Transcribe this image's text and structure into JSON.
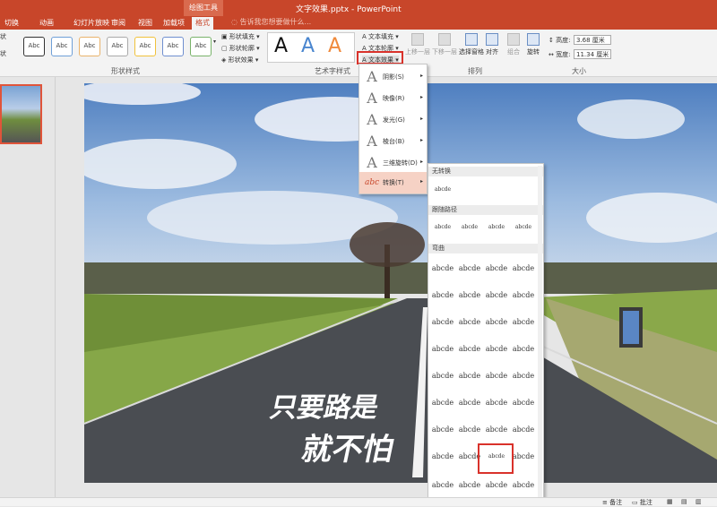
{
  "window": {
    "title": "文字效果.pptx - PowerPoint",
    "context_tab": "绘图工具"
  },
  "tabs": [
    "切换",
    "动画",
    "幻灯片放映",
    "审阅",
    "视图",
    "加载项",
    "格式"
  ],
  "active_tab": "格式",
  "tell_me": "告诉我您想要做什么...",
  "ribbon": {
    "left_partial": [
      "状",
      "状"
    ],
    "shape_styles": [
      "Abc",
      "Abc",
      "Abc",
      "Abc",
      "Abc",
      "Abc",
      "Abc"
    ],
    "shape_styles_label": "形状样式",
    "shape_fill": "形状填充",
    "shape_outline": "形状轮廓",
    "shape_effects": "形状效果",
    "wordart_samples": [
      "A",
      "A",
      "A"
    ],
    "wordart_label": "艺术字样式",
    "text_fill": "文本填充",
    "text_outline": "文本轮廓",
    "text_effects": "文本效果",
    "arrange": {
      "bring_forward": "上移一层",
      "send_backward": "下移一层",
      "selection_pane": "选择窗格",
      "align": "对齐",
      "group": "组合",
      "rotate": "旋转",
      "label": "排列"
    },
    "size": {
      "height_label": "高度:",
      "height_value": "3.68 厘米",
      "width_label": "宽度:",
      "width_value": "11.34 厘米",
      "label": "大小"
    }
  },
  "text_effects_menu": [
    {
      "label": "阴影(S)"
    },
    {
      "label": "映像(R)"
    },
    {
      "label": "发光(G)"
    },
    {
      "label": "棱台(B)"
    },
    {
      "label": "三维旋转(D)"
    },
    {
      "label": "转换(T)"
    }
  ],
  "transform_gallery": {
    "no_transform": "无转换",
    "no_transform_sample": "abcde",
    "follow_path": "跟随路径",
    "follow_path_samples": [
      "abcde",
      "abcde",
      "abcde",
      "abcde"
    ],
    "warp": "弯曲",
    "warp_samples": [
      "abcde",
      "abcde",
      "abcde",
      "abcde"
    ]
  },
  "slide_text": {
    "line1": "只要路是",
    "line2": "就不怕"
  },
  "statusbar": {
    "notes": "备注",
    "comments": "批注"
  },
  "colors": {
    "accent": "#c8462a",
    "highlight": "#d9322b"
  }
}
